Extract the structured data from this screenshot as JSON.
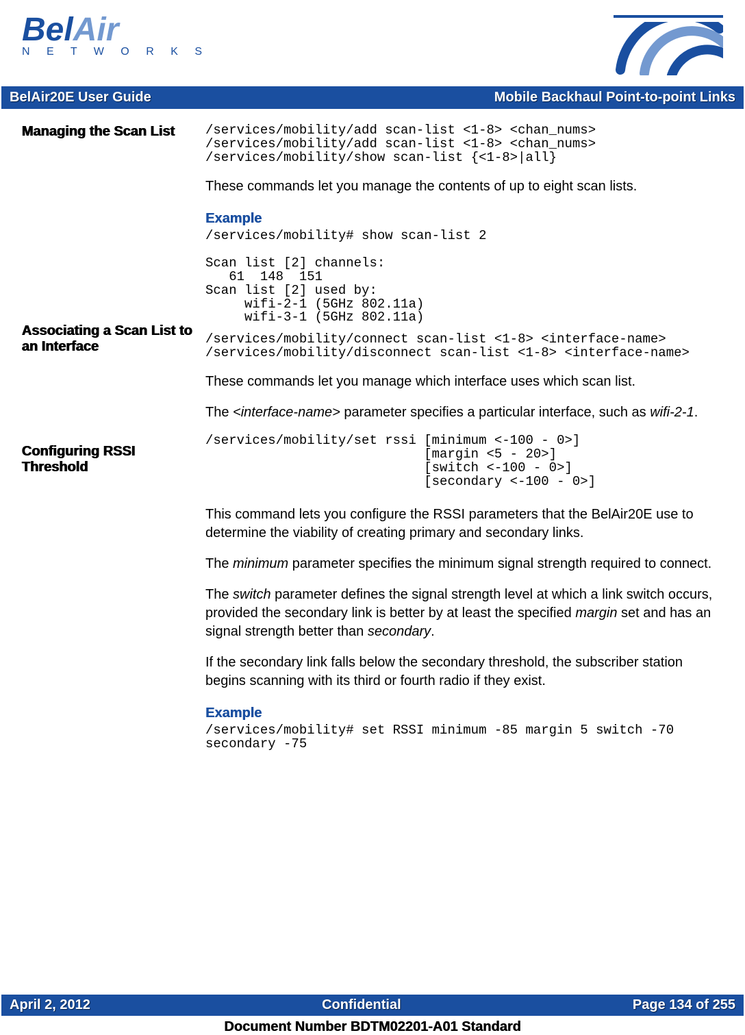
{
  "header": {
    "brand_part1": "Bel",
    "brand_part2": "Air",
    "brand_sub": "N E T W O R K S",
    "title_left": "BelAir20E User Guide",
    "title_right": "Mobile Backhaul Point-to-point Links"
  },
  "sections": [
    {
      "heading": "Managing the Scan List",
      "code1": "/services/mobility/add scan-list <1-8> <chan_nums>\n/services/mobility/add scan-list <1-8> <chan_nums>\n/services/mobility/show scan-list {<1-8>|all}",
      "body1": "These commands let you manage the contents of up to eight scan lists.",
      "example_label": "Example",
      "example_code": "/services/mobility# show scan-list 2\n\nScan list [2] channels:\n   61  148  151\nScan list [2] used by:\n     wifi-2-1 (5GHz 802.11a)\n     wifi-3-1 (5GHz 802.11a)"
    },
    {
      "heading": "Associating a Scan List to an Interface",
      "code1": "/services/mobility/connect scan-list <1-8> <interface-name>\n/services/mobility/disconnect scan-list <1-8> <interface-name>",
      "body1": "These commands let you manage which interface uses which scan list.",
      "body2_pre": "The ",
      "body2_em": "<interface-name>",
      "body2_post": " parameter specifies a particular interface, such as ",
      "body2_em2": "wifi-2-1",
      "body2_end": "."
    },
    {
      "heading": "Configuring RSSI Threshold",
      "code1": "/services/mobility/set rssi [minimum <-100 - 0>]\n                            [margin <5 - 20>]\n                            [switch <-100 - 0>]\n                            [secondary <-100 - 0>]",
      "body1": "This command lets you configure the RSSI parameters that the BelAir20E use to determine the viability of creating primary and secondary links.",
      "p2_pre": "The ",
      "p2_em": "minimum",
      "p2_post": " parameter specifies the minimum signal strength required to connect.",
      "p3_pre": "The ",
      "p3_em1": "switch",
      "p3_mid1": " parameter defines the signal strength level at which a link switch occurs, provided the secondary link is better by at least the specified ",
      "p3_em2": "margin",
      "p3_mid2": " set and has an signal strength better than ",
      "p3_em3": "secondary",
      "p3_end": ".",
      "p4": "If the secondary link falls below the secondary threshold, the subscriber station begins scanning with its third or fourth radio if they exist.",
      "example_label": "Example",
      "example_code": "/services/mobility# set RSSI minimum -85 margin 5 switch -70 secondary -75"
    }
  ],
  "footer": {
    "date": "April 2, 2012",
    "confidential": "Confidential",
    "page": "Page 134 of 255",
    "doc_number": "Document Number BDTM02201-A01 Standard"
  }
}
